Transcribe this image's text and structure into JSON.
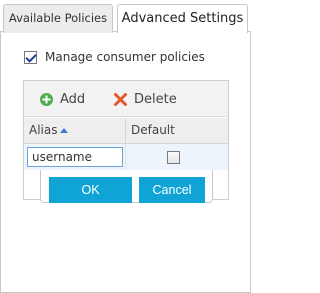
{
  "tabs": {
    "available": "Available Policies",
    "advanced": "Advanced Settings"
  },
  "manage": {
    "label": "Manage consumer policies",
    "checked": true
  },
  "toolbar": {
    "add_label": "Add",
    "delete_label": "Delete"
  },
  "grid": {
    "columns": {
      "alias": "Alias",
      "default": "Default"
    },
    "sort": "alias ascending",
    "row": {
      "alias_value": "username",
      "default_checked": false
    }
  },
  "editor": {
    "ok_label": "OK",
    "cancel_label": "Cancel"
  },
  "colors": {
    "button_bg": "#10a3d6",
    "add_icon": "#4cae4c",
    "delete_icon": "#e8572b",
    "sort_arrow": "#3a7bd5"
  }
}
